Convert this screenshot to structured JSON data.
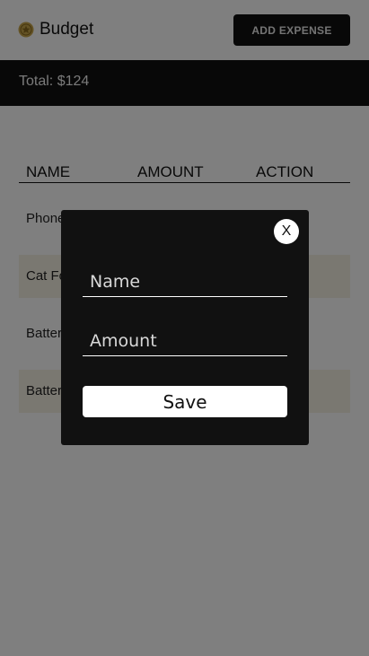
{
  "header": {
    "brand": "Budget",
    "logo_icon": "coin-icon",
    "add_button_label": "ADD EXPENSE"
  },
  "summary": {
    "total_label": "Total: $124"
  },
  "table": {
    "columns": [
      "NAME",
      "AMOUNT",
      "ACTION"
    ],
    "rows": [
      {
        "name": "Phone"
      },
      {
        "name": "Cat Fo"
      },
      {
        "name": "Batter"
      },
      {
        "name": "Batter"
      }
    ]
  },
  "modal": {
    "close_label": "X",
    "name_placeholder": "Name",
    "amount_placeholder": "Amount",
    "save_label": "Save"
  },
  "colors": {
    "dark": "#111111",
    "row_alt": "#f5f0e2",
    "overlay": "rgba(0,0,0,0.5)",
    "logo_gold": "#c9a64a"
  }
}
